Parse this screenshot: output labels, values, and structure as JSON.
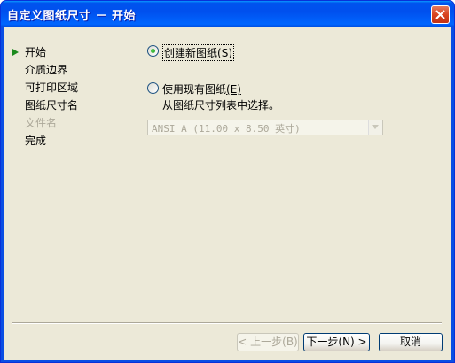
{
  "window": {
    "title": "自定义图纸尺寸 － 开始"
  },
  "nav": {
    "items": [
      {
        "label": "开始",
        "state": "current"
      },
      {
        "label": "介质边界",
        "state": "normal"
      },
      {
        "label": "可打印区域",
        "state": "normal"
      },
      {
        "label": "图纸尺寸名",
        "state": "normal"
      },
      {
        "label": "文件名",
        "state": "disabled"
      },
      {
        "label": "完成",
        "state": "normal"
      }
    ]
  },
  "options": {
    "create_new": {
      "label": "创建新图纸",
      "mnemonic": "(S)",
      "selected": true
    },
    "use_existing": {
      "label": "使用现有图纸",
      "mnemonic": "(E)",
      "selected": false
    },
    "list_hint": "从图纸尺寸列表中选择。",
    "paper_select": {
      "value": "ANSI A (11.00 x 8.50 英寸)",
      "enabled": false
    }
  },
  "buttons": {
    "back": {
      "label": "< 上一步(B)",
      "enabled": false
    },
    "next": {
      "label": "下一步(N) >",
      "enabled": true
    },
    "cancel": {
      "label": "取消",
      "enabled": true
    }
  },
  "colors": {
    "titlebar": "#0053ee",
    "dialog_bg": "#ece9d8",
    "current_arrow": "#1c8a1c",
    "disabled_text": "#aca899"
  }
}
